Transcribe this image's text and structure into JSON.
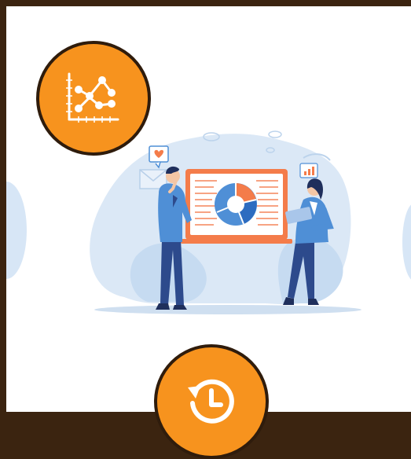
{
  "card": {
    "illustration": "analytics-team-presentation",
    "colors": {
      "background": "#ffffff",
      "blob": "#dbe8f6",
      "orange": "#f47c4a",
      "blue_dark": "#2d4a8c",
      "blue_light": "#4f8fd6"
    }
  },
  "badges": {
    "chart_icon": "line-chart-icon",
    "history_icon": "history-icon",
    "accent": "#f7931e",
    "border": "#2f1c0c"
  },
  "frame": {
    "background": "#3b2410"
  }
}
